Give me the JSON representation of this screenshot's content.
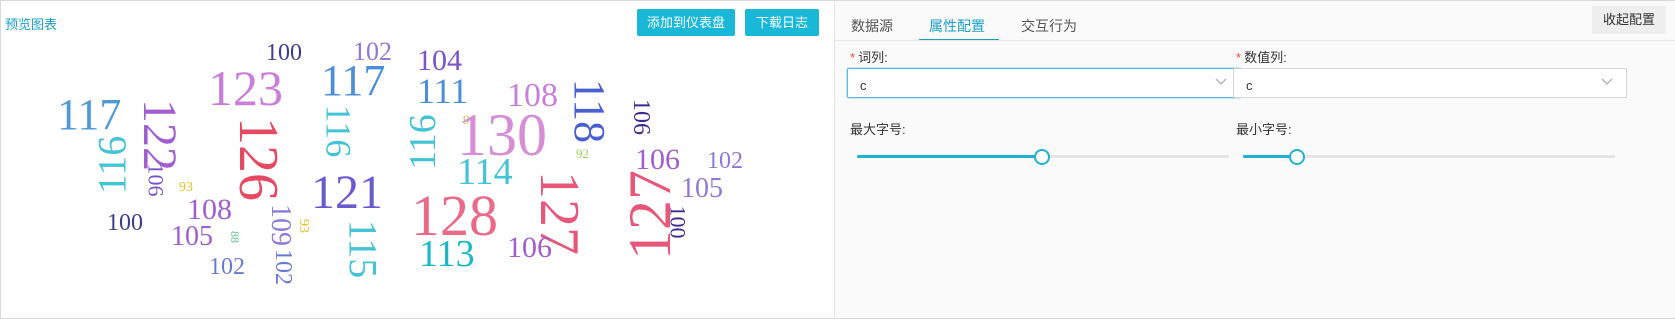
{
  "preview": {
    "title": "预览图表",
    "add_to_dashboard": "添加到仪表盘",
    "download_log": "下载日志"
  },
  "wordcloud": [
    {
      "text": "100",
      "color": "#3a3f8a"
    },
    {
      "text": "102",
      "color": "#8a7bd6"
    },
    {
      "text": "104",
      "color": "#7b52c7"
    },
    {
      "text": "117",
      "color": "#4f9ad6"
    },
    {
      "text": "123",
      "color": "#c97ed9"
    },
    {
      "text": "117",
      "color": "#4a8fd8"
    },
    {
      "text": "111",
      "color": "#4a8fd8"
    },
    {
      "text": "108",
      "color": "#c97ed9"
    },
    {
      "text": "118",
      "color": "#4a5fd0"
    },
    {
      "text": "122",
      "color": "#a05ed0"
    },
    {
      "text": "116",
      "color": "#42c3d6"
    },
    {
      "text": "126",
      "color": "#e64a62"
    },
    {
      "text": "116",
      "color": "#42c3d6"
    },
    {
      "text": "116",
      "color": "#42c3d6"
    },
    {
      "text": "91",
      "color": "#c8c83a"
    },
    {
      "text": "130",
      "color": "#d68ed6"
    },
    {
      "text": "106",
      "color": "#3a2c8a"
    },
    {
      "text": "92",
      "color": "#9ad05a"
    },
    {
      "text": "106",
      "color": "#a05ed0"
    },
    {
      "text": "102",
      "color": "#8a7bd6"
    },
    {
      "text": "105",
      "color": "#8a7bd6"
    },
    {
      "text": "93",
      "color": "#e6c020"
    },
    {
      "text": "106",
      "color": "#7b52c7"
    },
    {
      "text": "121",
      "color": "#6a5ad0"
    },
    {
      "text": "114",
      "color": "#42c3d6"
    },
    {
      "text": "127",
      "color": "#e6587a"
    },
    {
      "text": "127",
      "color": "#e6587a"
    },
    {
      "text": "108",
      "color": "#a05ed0"
    },
    {
      "text": "100",
      "color": "#3a3f8a"
    },
    {
      "text": "109",
      "color": "#8a7bd6"
    },
    {
      "text": "93",
      "color": "#e6c020"
    },
    {
      "text": "128",
      "color": "#ea6a88"
    },
    {
      "text": "115",
      "color": "#42c3d6"
    },
    {
      "text": "105",
      "color": "#a05ed0"
    },
    {
      "text": "88",
      "color": "#5ac08a"
    },
    {
      "text": "100",
      "color": "#3a2c8a"
    },
    {
      "text": "102",
      "color": "#6a7ad0"
    },
    {
      "text": "102",
      "color": "#6a7ad0"
    },
    {
      "text": "113",
      "color": "#1ab8c8"
    },
    {
      "text": "106",
      "color": "#a05ed0"
    }
  ],
  "panel": {
    "tabs": [
      "数据源",
      "属性配置",
      "交互行为"
    ],
    "active_tab": "属性配置",
    "collapse_label": "收起配置",
    "word_column": {
      "required_mark": "*",
      "label": "词列:",
      "value": "c"
    },
    "value_column": {
      "required_mark": "*",
      "label": "数值列:",
      "value": "c"
    },
    "max_font": {
      "label": "最大字号:",
      "level": 0.495
    },
    "min_font": {
      "label": "最小字号:",
      "level": 0.143
    }
  },
  "colors": {
    "accent": "#19b8d8",
    "link": "#1aa0c8",
    "required": "#e84c3d"
  }
}
